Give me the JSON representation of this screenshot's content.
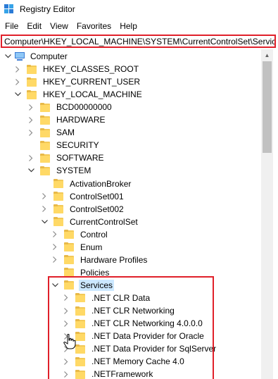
{
  "window": {
    "title": "Registry Editor"
  },
  "menu": [
    {
      "label": "File"
    },
    {
      "label": "Edit"
    },
    {
      "label": "View"
    },
    {
      "label": "Favorites"
    },
    {
      "label": "Help"
    }
  ],
  "address": {
    "value": "Computer\\HKEY_LOCAL_MACHINE\\SYSTEM\\CurrentControlSet\\Services"
  },
  "tree": [
    {
      "label": "Computer",
      "expanded": true,
      "icon": "computer-icon",
      "level": 0
    },
    {
      "label": "HKEY_CLASSES_ROOT",
      "expanded": false,
      "icon": "folder-icon",
      "level": 1
    },
    {
      "label": "HKEY_CURRENT_USER",
      "expanded": false,
      "icon": "folder-icon",
      "level": 1
    },
    {
      "label": "HKEY_LOCAL_MACHINE",
      "expanded": true,
      "icon": "folder-icon",
      "level": 1
    },
    {
      "label": "BCD00000000",
      "expanded": false,
      "icon": "folder-icon",
      "level": 2
    },
    {
      "label": "HARDWARE",
      "expanded": false,
      "icon": "folder-icon",
      "level": 2
    },
    {
      "label": "SAM",
      "expanded": false,
      "icon": "folder-icon",
      "level": 2
    },
    {
      "label": "SECURITY",
      "expanded": null,
      "icon": "folder-icon",
      "level": 2
    },
    {
      "label": "SOFTWARE",
      "expanded": false,
      "icon": "folder-icon",
      "level": 2
    },
    {
      "label": "SYSTEM",
      "expanded": true,
      "icon": "folder-icon",
      "level": 2
    },
    {
      "label": "ActivationBroker",
      "expanded": null,
      "icon": "folder-icon",
      "level": 3
    },
    {
      "label": "ControlSet001",
      "expanded": false,
      "icon": "folder-icon",
      "level": 3
    },
    {
      "label": "ControlSet002",
      "expanded": false,
      "icon": "folder-icon",
      "level": 3
    },
    {
      "label": "CurrentControlSet",
      "expanded": true,
      "icon": "folder-icon",
      "level": 3
    },
    {
      "label": "Control",
      "expanded": false,
      "icon": "folder-icon",
      "level": 4
    },
    {
      "label": "Enum",
      "expanded": false,
      "icon": "folder-icon",
      "level": 4
    },
    {
      "label": "Hardware Profiles",
      "expanded": false,
      "icon": "folder-icon",
      "level": 4
    },
    {
      "label": "Policies",
      "expanded": null,
      "icon": "folder-icon",
      "level": 4
    },
    {
      "label": "Services",
      "expanded": true,
      "icon": "folder-icon",
      "level": 4,
      "selected": true
    },
    {
      "label": ".NET CLR Data",
      "expanded": false,
      "icon": "folder-icon",
      "level": 5
    },
    {
      "label": ".NET CLR Networking",
      "expanded": false,
      "icon": "folder-icon",
      "level": 5
    },
    {
      "label": ".NET CLR Networking 4.0.0.0",
      "expanded": false,
      "icon": "folder-icon",
      "level": 5
    },
    {
      "label": ".NET Data Provider for Oracle",
      "expanded": false,
      "icon": "folder-icon",
      "level": 5
    },
    {
      "label": ".NET Data Provider for SqlServer",
      "expanded": false,
      "icon": "folder-icon",
      "level": 5
    },
    {
      "label": ".NET Memory Cache 4.0",
      "expanded": false,
      "icon": "folder-icon",
      "level": 5
    },
    {
      "label": ".NETFramework",
      "expanded": false,
      "icon": "folder-icon",
      "level": 5
    }
  ],
  "colors": {
    "highlight": "#e0202a",
    "selection": "#cce8ff",
    "folder": "#ffd966"
  }
}
